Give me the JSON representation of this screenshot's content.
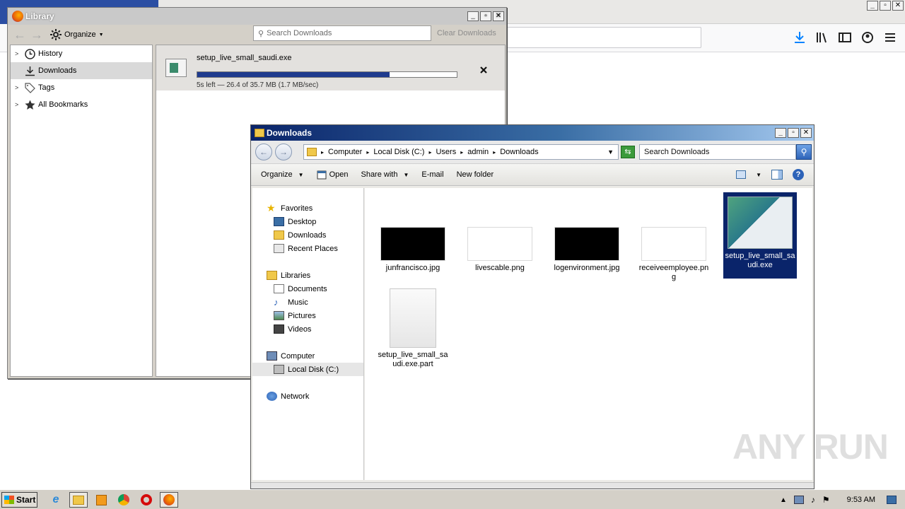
{
  "firefox": {
    "caption": {
      "minimize": "_",
      "restore": "▫",
      "close": "✕"
    }
  },
  "library": {
    "title": "Library",
    "organize_label": "Organize",
    "search_placeholder": "Search Downloads",
    "clear_label": "Clear Downloads",
    "tree": [
      {
        "label": "History",
        "icon": "clock-icon",
        "expandable": true
      },
      {
        "label": "Downloads",
        "icon": "download-icon",
        "expandable": false,
        "selected": true
      },
      {
        "label": "Tags",
        "icon": "tag-icon",
        "expandable": true
      },
      {
        "label": "All Bookmarks",
        "icon": "star-icon",
        "expandable": true
      }
    ],
    "download": {
      "filename": "setup_live_small_saudi.exe",
      "status": "5s left — 26.4 of 35.7 MB (1.7 MB/sec)",
      "progress_fraction": 0.74
    }
  },
  "explorer": {
    "title": "Downloads",
    "breadcrumb": [
      "Computer",
      "Local Disk (C:)",
      "Users",
      "admin",
      "Downloads"
    ],
    "search_text": "Search Downloads",
    "commands": {
      "organize": "Organize",
      "open": "Open",
      "share_with": "Share with",
      "email": "E-mail",
      "new_folder": "New folder"
    },
    "nav": {
      "favorites": "Favorites",
      "favorites_items": [
        "Desktop",
        "Downloads",
        "Recent Places"
      ],
      "libraries": "Libraries",
      "libraries_items": [
        "Documents",
        "Music",
        "Pictures",
        "Videos"
      ],
      "computer": "Computer",
      "computer_items": [
        "Local Disk (C:)"
      ],
      "network": "Network"
    },
    "files": [
      {
        "name": "junfrancisco.jpg"
      },
      {
        "name": "livescable.png"
      },
      {
        "name": "logenvironment.jpg"
      },
      {
        "name": "receiveemployee.png"
      },
      {
        "name": "setup_live_small_saudi.exe"
      },
      {
        "name": "setup_live_small_saudi.exe.part"
      }
    ]
  },
  "taskbar": {
    "start_label": "Start",
    "clock": "9:53 AM"
  },
  "watermark": "ANY RUN"
}
